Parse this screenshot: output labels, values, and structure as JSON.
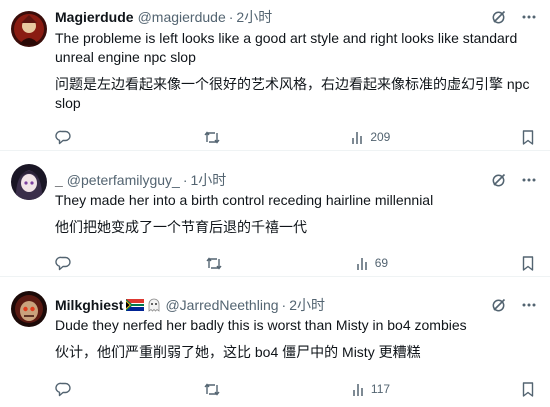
{
  "colors": {
    "text": "#0f1419",
    "muted": "#536471",
    "divider": "#eff3f4"
  },
  "icons": {
    "grok": "grok-icon",
    "more": "more-icon",
    "reply": "reply-icon",
    "retweet": "retweet-icon",
    "views": "views-icon",
    "bookmark": "bookmark-icon"
  },
  "tweets": [
    {
      "name": "Magierdude",
      "handle": "@magierdude",
      "separator": "·",
      "time": "2小时",
      "text_en": "The probleme is left looks like a good art style and right looks like standard unreal engine npc slop",
      "text_zh": "问题是左边看起来像一个很好的艺术风格，右边看起来像标准的虚幻引擎 npc slop",
      "views": "209"
    },
    {
      "name": "_",
      "handle": "@peterfamilyguy_",
      "separator": "·",
      "time": "1小时",
      "text_en": "They made her into a birth control receding hairline millennial",
      "text_zh": "他们把她变成了一个节育后退的千禧一代",
      "views": "69"
    },
    {
      "name": "Milkghiest",
      "handle": "@JarredNeethling",
      "separator": "·",
      "time": "2小时",
      "text_en": "Dude they nerfed her badly this is worst than Misty in bo4 zombies",
      "text_zh": "伙计，他们严重削弱了她，这比 bo4 僵尸中的 Misty 更糟糕",
      "views": "117"
    }
  ]
}
